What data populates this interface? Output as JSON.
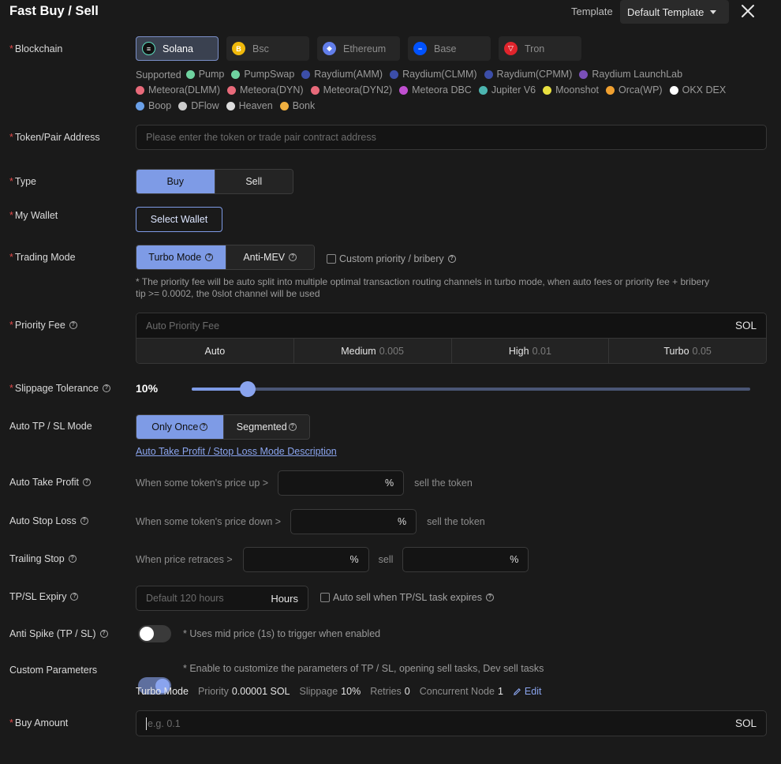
{
  "header": {
    "title": "Fast Buy / Sell",
    "template_label": "Template",
    "template_value": "Default Template"
  },
  "blockchain": {
    "label": "Blockchain",
    "chains": [
      {
        "name": "Solana",
        "active": true,
        "color": "#111111"
      },
      {
        "name": "Bsc",
        "active": false,
        "color": "#f0b90b"
      },
      {
        "name": "Ethereum",
        "active": false,
        "color": "#627eea"
      },
      {
        "name": "Base",
        "active": false,
        "color": "#0052ff"
      },
      {
        "name": "Tron",
        "active": false,
        "color": "#e0242c"
      }
    ],
    "supported_label": "Supported",
    "dex_rows": [
      [
        "Pump",
        "PumpSwap",
        "Raydium(AMM)",
        "Raydium(CLMM)",
        "Raydium(CPMM)",
        "Raydium LaunchLab"
      ],
      [
        "Meteora(DLMM)",
        "Meteora(DYN)",
        "Meteora(DYN2)",
        "Meteora DBC",
        "Jupiter V6",
        "Moonshot",
        "Orca(WP)",
        "OKX DEX"
      ],
      [
        "Boop",
        "DFlow",
        "Heaven",
        "Bonk"
      ]
    ]
  },
  "token": {
    "label": "Token/Pair Address",
    "placeholder": "Please enter the token or trade pair contract address"
  },
  "type": {
    "label": "Type",
    "buy": "Buy",
    "sell": "Sell"
  },
  "wallet": {
    "label": "My Wallet",
    "button": "Select Wallet"
  },
  "trading_mode": {
    "label": "Trading Mode",
    "turbo": "Turbo Mode",
    "antimev": "Anti-MEV",
    "custom_priority": "Custom priority / bribery",
    "note_line1": "* The priority fee will be auto split into multiple optimal transaction routing channels in turbo mode, when auto fees or priority fee + bribery",
    "note_line2": "tip >= 0.0002, the 0slot channel will be used"
  },
  "priority_fee": {
    "label": "Priority Fee",
    "placeholder": "Auto Priority Fee",
    "unit": "SOL",
    "options": [
      {
        "name": "Auto",
        "value": ""
      },
      {
        "name": "Medium",
        "value": "0.005"
      },
      {
        "name": "High",
        "value": "0.01"
      },
      {
        "name": "Turbo",
        "value": "0.05"
      }
    ]
  },
  "slippage": {
    "label": "Slippage Tolerance",
    "value": "10%",
    "fraction": 0.1
  },
  "tpsl_mode": {
    "label": "Auto TP / SL Mode",
    "once": "Only Once",
    "segmented": "Segmented",
    "link": "Auto Take Profit / Stop Loss Mode Description"
  },
  "take_profit": {
    "label": "Auto Take Profit",
    "prefix": "When some token's price up >",
    "unit": "%",
    "suffix": "sell the token"
  },
  "stop_loss": {
    "label": "Auto Stop Loss",
    "prefix": "When some token's price down >",
    "unit": "%",
    "suffix": "sell the token"
  },
  "trailing": {
    "label": "Trailing Stop",
    "prefix": "When price retraces >",
    "unit": "%",
    "mid": "sell",
    "unit2": "%"
  },
  "expiry": {
    "label": "TP/SL Expiry",
    "placeholder": "Default 120 hours",
    "unit": "Hours",
    "auto_sell": "Auto sell when TP/SL task expires"
  },
  "anti_spike": {
    "label": "Anti Spike (TP / SL)",
    "note": "* Uses mid price (1s) to trigger when enabled"
  },
  "custom_params": {
    "label": "Custom Parameters",
    "note": "* Enable to customize the parameters of TP / SL, opening sell tasks, Dev sell tasks",
    "mode": "Turbo Mode",
    "priority_label": "Priority",
    "priority_value": "0.00001 SOL",
    "slippage_label": "Slippage",
    "slippage_value": "10%",
    "retries_label": "Retries",
    "retries_value": "0",
    "node_label": "Concurrent Node",
    "node_value": "1",
    "edit": "Edit"
  },
  "buy_amount": {
    "label": "Buy Amount",
    "placeholder": "e.g. 0.1",
    "unit": "SOL"
  },
  "colors": {
    "accent": "#7e9be6",
    "required": "#e04a4a",
    "background": "#1a1a1a"
  }
}
